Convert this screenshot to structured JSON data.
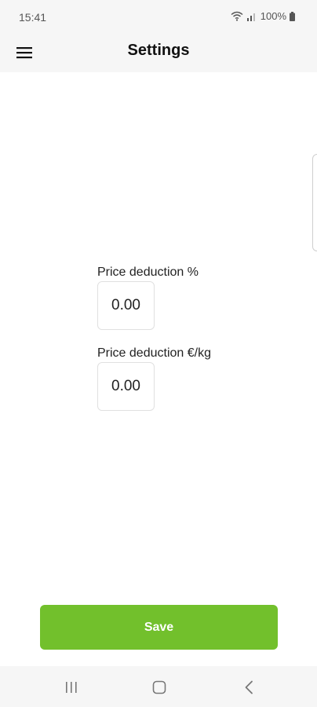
{
  "status_bar": {
    "time": "15:41",
    "battery": "100%"
  },
  "app_bar": {
    "title": "Settings",
    "menu_icon": "hamburger-menu-icon"
  },
  "form": {
    "price_deduction_percent": {
      "label": "Price deduction %",
      "value": "0.00"
    },
    "price_deduction_per_kg": {
      "label": "Price deduction €/kg",
      "value": "0.00"
    }
  },
  "actions": {
    "save_label": "Save"
  },
  "nav_bar": {
    "recents_icon": "recent-apps-icon",
    "home_icon": "home-icon",
    "back_icon": "back-icon"
  },
  "colors": {
    "accent": "#72c02c",
    "bar_background": "#f6f6f6"
  }
}
